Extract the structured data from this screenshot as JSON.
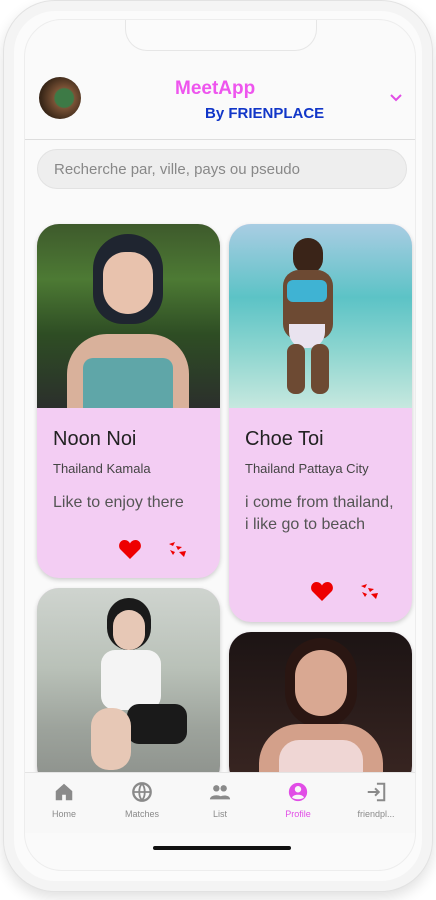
{
  "header": {
    "title": "MeetApp",
    "subtitle": "By FRIENPLACE"
  },
  "search": {
    "placeholder": "Recherche par, ville, pays ou pseudo"
  },
  "cards": [
    {
      "name": "Noon Noi",
      "location": "Thailand Kamala",
      "description": "Like to enjoy there"
    },
    {
      "name": "Choe Toi",
      "location": "Thailand Pattaya City",
      "description": "i come from thailand, i like go to beach"
    }
  ],
  "nav": {
    "items": [
      {
        "label": "Home",
        "icon": "home-icon"
      },
      {
        "label": "Matches",
        "icon": "globe-icon"
      },
      {
        "label": "List",
        "icon": "people-icon"
      },
      {
        "label": "Profile",
        "icon": "account-circle-icon",
        "active": true
      },
      {
        "label": "friendpl...",
        "icon": "login-icon"
      }
    ]
  },
  "colors": {
    "title": "#ee55ee",
    "subtitle": "#1136c8",
    "card": "#f3cdf3",
    "heart": "#ee0000",
    "active_nav": "#e14de6"
  }
}
